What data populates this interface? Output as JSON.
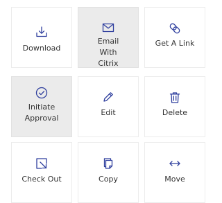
{
  "accent_color": "#2f3f9e",
  "actions": [
    {
      "id": "download",
      "label": "Download",
      "icon": "download-icon",
      "highlighted": false
    },
    {
      "id": "email-with-citrix",
      "label": "Email With Citrix",
      "icon": "envelope-icon",
      "highlighted": true
    },
    {
      "id": "get-a-link",
      "label": "Get A Link",
      "icon": "link-icon",
      "highlighted": false
    },
    {
      "id": "initiate-approval",
      "label": "Initiate Approval",
      "icon": "approval-check-icon",
      "highlighted": true
    },
    {
      "id": "edit",
      "label": "Edit",
      "icon": "pencil-icon",
      "highlighted": false
    },
    {
      "id": "delete",
      "label": "Delete",
      "icon": "trash-icon",
      "highlighted": false
    },
    {
      "id": "check-out",
      "label": "Check Out",
      "icon": "check-out-icon",
      "highlighted": false
    },
    {
      "id": "copy",
      "label": "Copy",
      "icon": "copy-icon",
      "highlighted": false
    },
    {
      "id": "move",
      "label": "Move",
      "icon": "move-arrows-icon",
      "highlighted": false
    }
  ]
}
